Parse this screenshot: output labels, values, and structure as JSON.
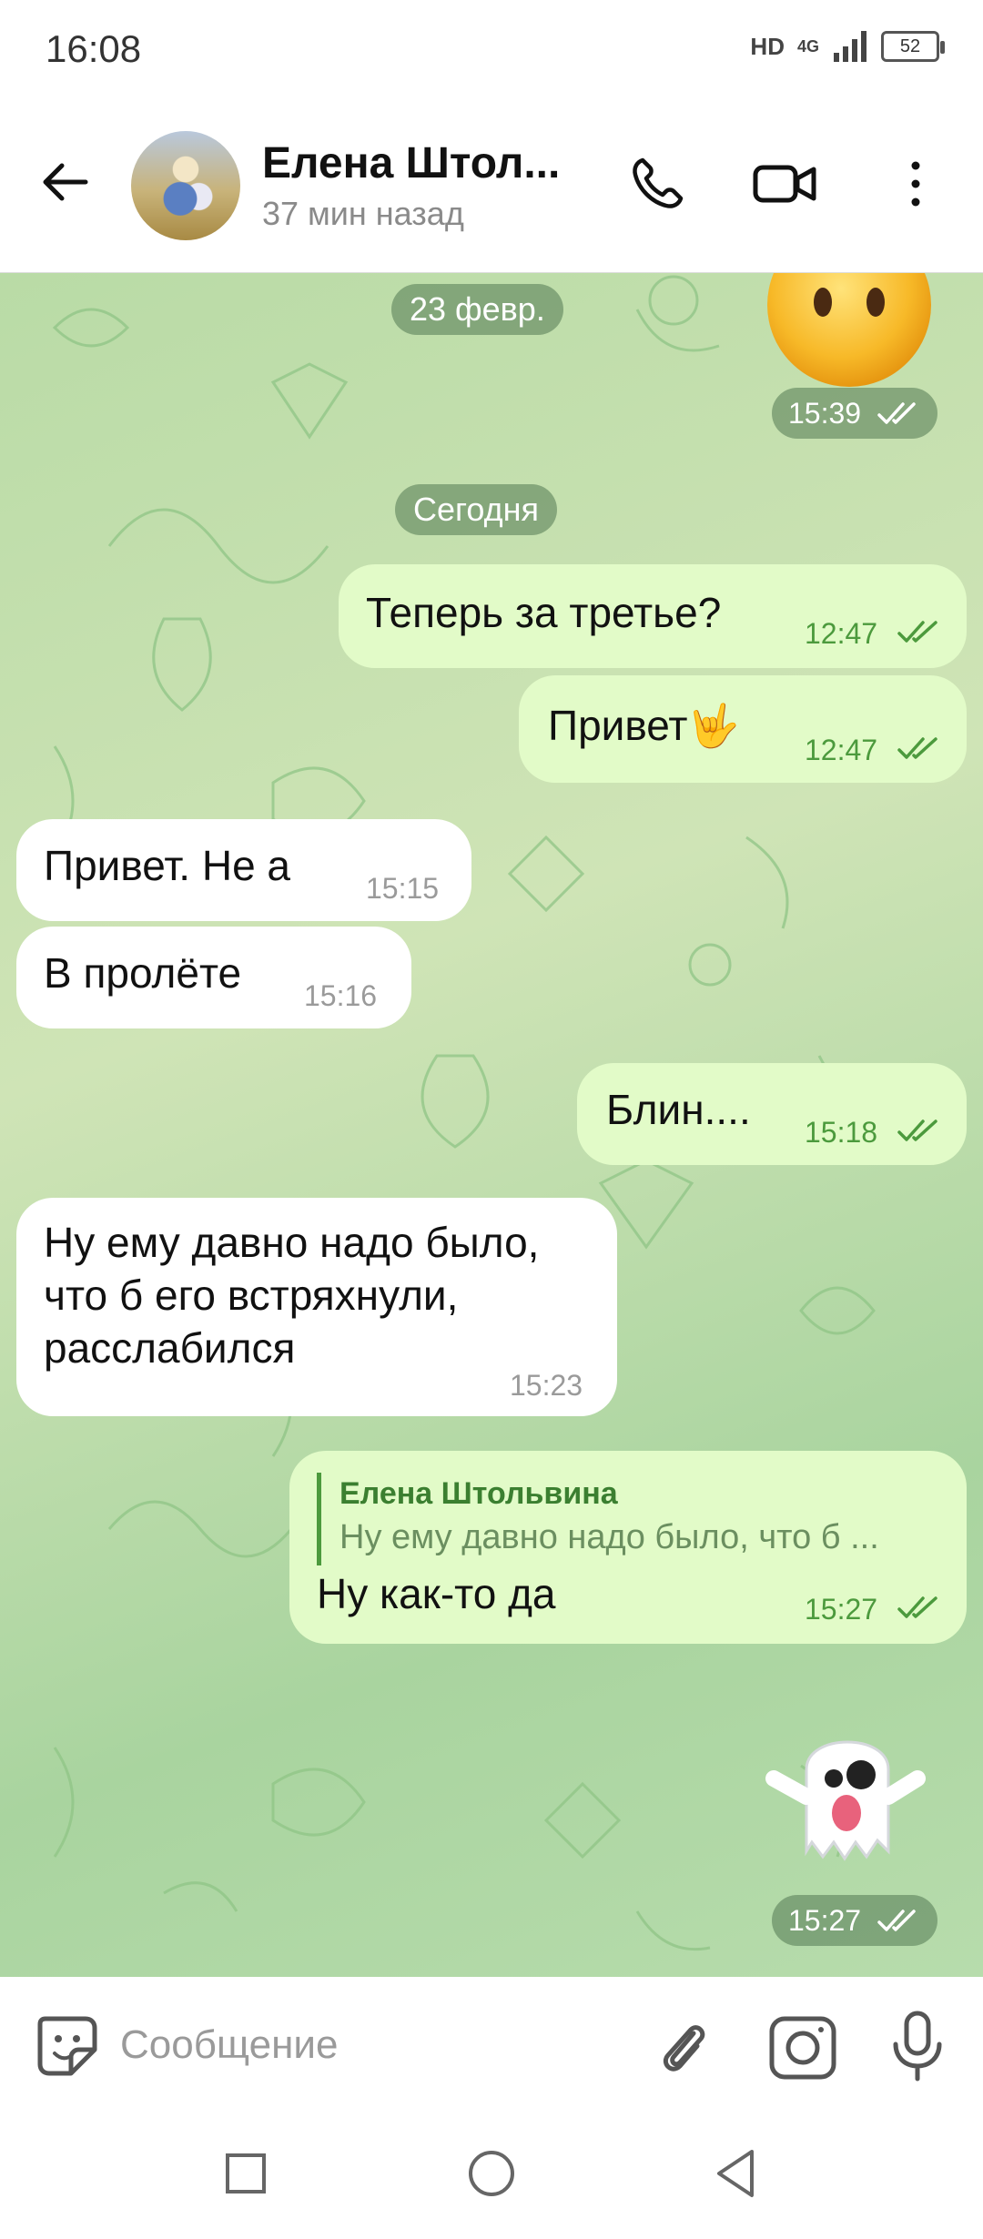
{
  "status_bar": {
    "time": "16:08",
    "hd": "HD",
    "network": "4G",
    "battery": "52"
  },
  "header": {
    "name": "Елена Штол...",
    "status": "37 мин назад"
  },
  "chat": {
    "dates": [
      "23 февр.",
      "Сегодня"
    ],
    "sticker1_time": "15:39",
    "messages": [
      {
        "dir": "out",
        "text": "Теперь за третье?",
        "time": "12:47"
      },
      {
        "dir": "out",
        "text": "Привет🤟",
        "time": "12:47"
      },
      {
        "dir": "in",
        "text": "Привет. Не а",
        "time": "15:15"
      },
      {
        "dir": "in",
        "text": "В пролёте",
        "time": "15:16"
      },
      {
        "dir": "out",
        "text": "Блин....",
        "time": "15:18"
      },
      {
        "dir": "in",
        "lines": [
          "Ну ему давно надо было,",
          "что б его встряхнули,",
          "расслабился"
        ],
        "time": "15:23"
      },
      {
        "dir": "out",
        "reply_name": "Елена Штольвина",
        "reply_text": "Ну ему давно надо было, что б ...",
        "text": "Ну как-то да",
        "time": "15:27"
      }
    ],
    "sticker2_time": "15:27"
  },
  "input": {
    "placeholder": "Сообщение"
  },
  "colors": {
    "out_bubble": "#e2fbc8",
    "in_bubble": "#ffffff",
    "accent": "#4c9a3d",
    "wallpaper": "#b9dba6"
  }
}
